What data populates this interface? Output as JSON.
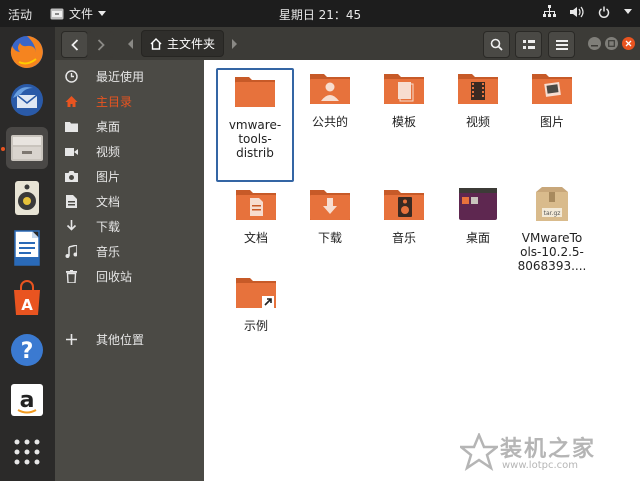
{
  "topbar": {
    "activities": "活动",
    "app_menu": "文件",
    "clock": "星期日 21：45"
  },
  "dock": {
    "items": [
      "firefox-icon",
      "thunderbird-icon",
      "files-icon",
      "rhythmbox-icon",
      "writer-icon",
      "software-icon",
      "help-icon",
      "amazon-icon",
      "show-apps-icon"
    ],
    "active": "files-icon"
  },
  "headerbar": {
    "path_current": "主文件夹"
  },
  "sidebar": {
    "items": [
      {
        "label": "最近使用",
        "icon": "clock-icon"
      },
      {
        "label": "主目录",
        "icon": "home-icon"
      },
      {
        "label": "桌面",
        "icon": "folder-icon"
      },
      {
        "label": "视频",
        "icon": "video-icon"
      },
      {
        "label": "图片",
        "icon": "camera-icon"
      },
      {
        "label": "文档",
        "icon": "document-icon"
      },
      {
        "label": "下载",
        "icon": "download-icon"
      },
      {
        "label": "音乐",
        "icon": "music-icon"
      },
      {
        "label": "回收站",
        "icon": "trash-icon"
      },
      {
        "label": "其他位置",
        "icon": "plus-icon"
      }
    ],
    "active_index": 1
  },
  "files": [
    {
      "name": "vmware-tools-distrib",
      "label_lines": [
        "vmware-",
        "tools-",
        "distrib"
      ],
      "type": "folder",
      "selected": true
    },
    {
      "name": "公共的",
      "type": "folder-public"
    },
    {
      "name": "模板",
      "type": "folder-templates"
    },
    {
      "name": "视频",
      "type": "folder-videos"
    },
    {
      "name": "图片",
      "type": "folder-pictures"
    },
    {
      "name": "文档",
      "type": "folder-documents"
    },
    {
      "name": "下载",
      "type": "folder-downloads"
    },
    {
      "name": "音乐",
      "type": "folder-music"
    },
    {
      "name": "桌面",
      "type": "folder-desktop"
    },
    {
      "name": "VMwareTools-10.2.5-8068393....",
      "label_lines": [
        "VMwareTo",
        "ols-10.2.5-",
        "8068393...."
      ],
      "type": "archive",
      "archive_tag": "tar.gz"
    },
    {
      "name": "示例",
      "type": "folder-link"
    }
  ],
  "watermark": {
    "brand": "装机之家",
    "url": "www.lotpc.com"
  },
  "colors": {
    "accent": "#e95420",
    "folder": "#e7723c",
    "selection": "#3465a4"
  }
}
